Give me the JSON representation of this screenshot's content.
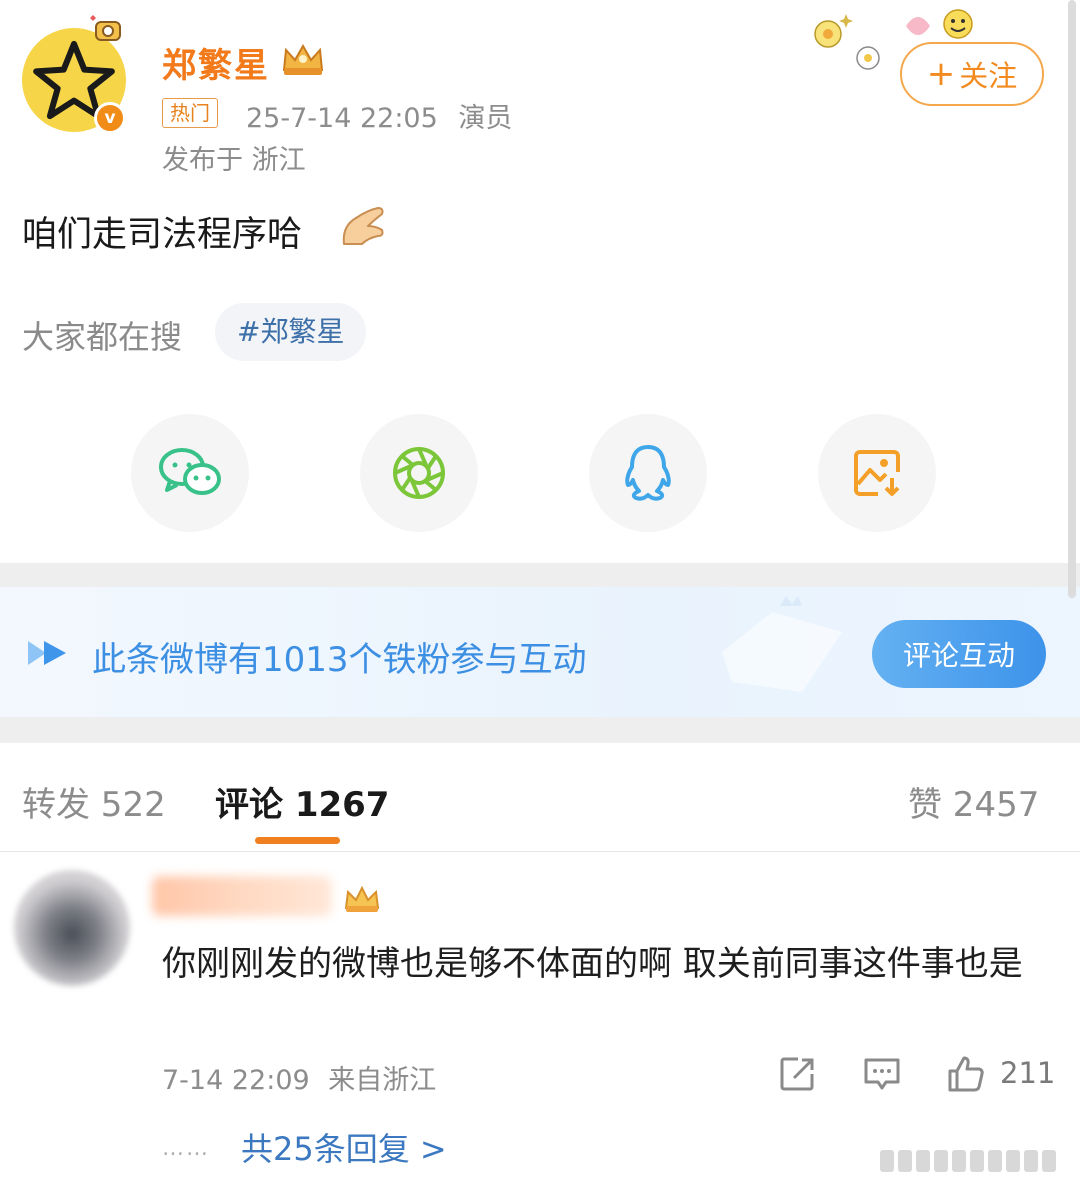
{
  "post": {
    "username": "郑繁星",
    "hot_tag": "热门",
    "datetime": "25-7-14 22:05",
    "role": "演员",
    "location": "发布于 浙江",
    "content": "咱们走司法程序哈",
    "follow_plus": "+",
    "follow_label": "关注"
  },
  "search": {
    "label": "大家都在搜",
    "chip": "#郑繁星"
  },
  "share_icons": [
    "wechat-icon",
    "moments-icon",
    "qq-icon",
    "save-image-icon"
  ],
  "banner": {
    "text": "此条微博有1013个铁粉参与互动",
    "button": "评论互动"
  },
  "tabs": {
    "repost": "转发 522",
    "comment": "评论 1267",
    "like": "赞 2457"
  },
  "comment": {
    "text": "你刚刚发的微博也是够不体面的啊 取关前同事这件事也是",
    "datetime": "7-14 22:09",
    "source": "来自浙江",
    "like_count": "211",
    "dots": "……",
    "replies": "共25条回复 >"
  },
  "colors": {
    "username": "#f27a1a",
    "accent_orange": "#f07f1f",
    "link_blue": "#3c78c0",
    "banner_blue": "#3c8fe3"
  }
}
